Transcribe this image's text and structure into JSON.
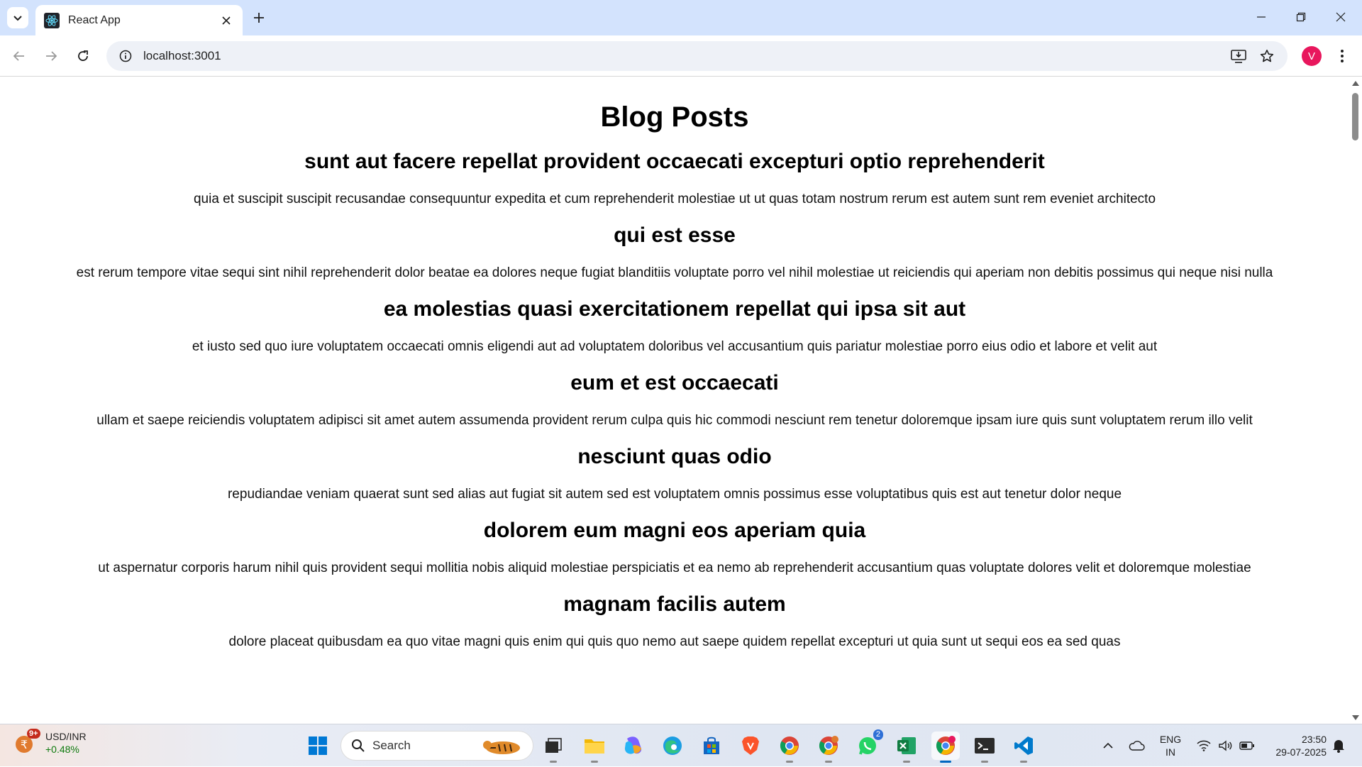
{
  "browser": {
    "tab": {
      "title": "React App"
    },
    "address": {
      "url": "localhost:3001"
    },
    "profile_initial": "V"
  },
  "page": {
    "title": "Blog Posts",
    "posts": [
      {
        "title": "sunt aut facere repellat provident occaecati excepturi optio reprehenderit",
        "body": "quia et suscipit suscipit recusandae consequuntur expedita et cum reprehenderit molestiae ut ut quas totam nostrum rerum est autem sunt rem eveniet architecto"
      },
      {
        "title": "qui est esse",
        "body": "est rerum tempore vitae sequi sint nihil reprehenderit dolor beatae ea dolores neque fugiat blanditiis voluptate porro vel nihil molestiae ut reiciendis qui aperiam non debitis possimus qui neque nisi nulla"
      },
      {
        "title": "ea molestias quasi exercitationem repellat qui ipsa sit aut",
        "body": "et iusto sed quo iure voluptatem occaecati omnis eligendi aut ad voluptatem doloribus vel accusantium quis pariatur molestiae porro eius odio et labore et velit aut"
      },
      {
        "title": "eum et est occaecati",
        "body": "ullam et saepe reiciendis voluptatem adipisci sit amet autem assumenda provident rerum culpa quis hic commodi nesciunt rem tenetur doloremque ipsam iure quis sunt voluptatem rerum illo velit"
      },
      {
        "title": "nesciunt quas odio",
        "body": "repudiandae veniam quaerat sunt sed alias aut fugiat sit autem sed est voluptatem omnis possimus esse voluptatibus quis est aut tenetur dolor neque"
      },
      {
        "title": "dolorem eum magni eos aperiam quia",
        "body": "ut aspernatur corporis harum nihil quis provident sequi mollitia nobis aliquid molestiae perspiciatis et ea nemo ab reprehenderit accusantium quas voluptate dolores velit et doloremque molestiae"
      },
      {
        "title": "magnam facilis autem",
        "body": "dolore placeat quibusdam ea quo vitae magni quis enim qui quis quo nemo aut saepe quidem repellat excepturi ut quia sunt ut sequi eos ea sed quas"
      }
    ]
  },
  "taskbar": {
    "widget": {
      "title": "USD/INR",
      "change": "+0.48%",
      "badge": "9+"
    },
    "search_label": "Search",
    "whatsapp_badge": "2",
    "chrome_profile_badge": "V",
    "language": {
      "line1": "ENG",
      "line2": "IN"
    },
    "clock": {
      "time": "23:50",
      "date": "29-07-2025"
    }
  },
  "colors": {
    "tabstrip_bg": "#d3e3fd",
    "omnibox_bg": "#eef1f7",
    "avatar": "#e8175d",
    "widget_change": "#0f7b0f",
    "accent": "#0067c0"
  }
}
